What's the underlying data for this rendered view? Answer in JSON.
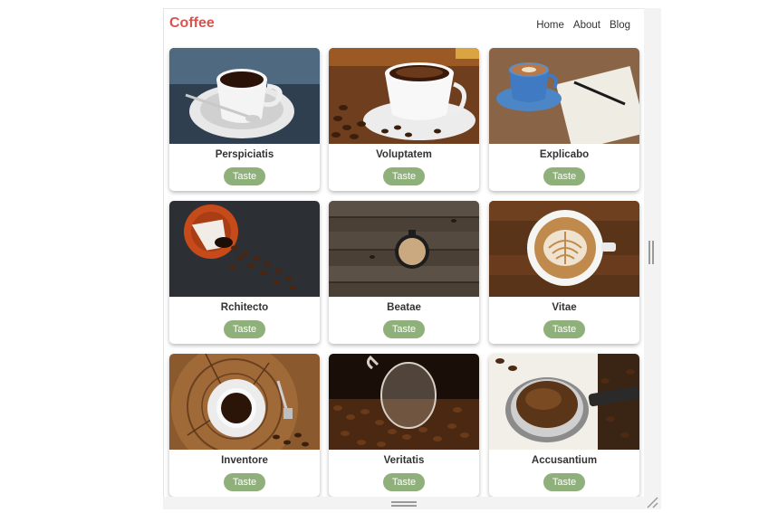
{
  "navbar": {
    "brand": "Coffee",
    "links": [
      "Home",
      "About",
      "Blog"
    ]
  },
  "cards": [
    {
      "title": "Perspiciatis",
      "button": "Taste",
      "image": "coffee-cup-on-saucer-with-spoon"
    },
    {
      "title": "Voluptatem",
      "button": "Taste",
      "image": "coffee-cup-with-beans"
    },
    {
      "title": "Explicabo",
      "button": "Taste",
      "image": "latte-with-notebook"
    },
    {
      "title": "Rchitecto",
      "button": "Taste",
      "image": "spilled-cup-beans"
    },
    {
      "title": "Beatae",
      "button": "Taste",
      "image": "cup-on-wood-table"
    },
    {
      "title": "Vitae",
      "button": "Taste",
      "image": "latte-art"
    },
    {
      "title": "Inventore",
      "button": "Taste",
      "image": "cup-on-tree-stump"
    },
    {
      "title": "Veritatis",
      "button": "Taste",
      "image": "glass-cup-in-beans"
    },
    {
      "title": "Accusantium",
      "button": "Taste",
      "image": "ground-coffee-portafilter"
    }
  ],
  "colors": {
    "brand": "#d9534f",
    "button": "#8fb07a"
  }
}
